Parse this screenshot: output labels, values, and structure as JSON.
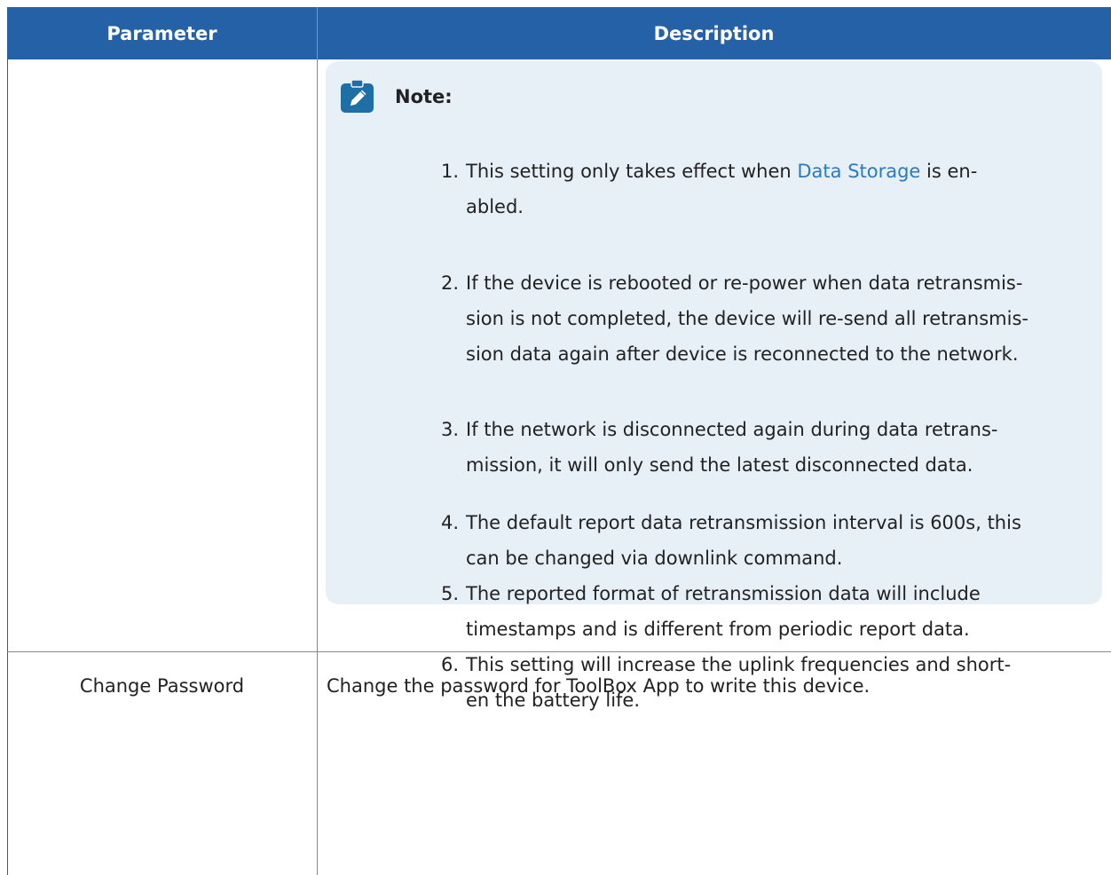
{
  "table": {
    "headers": {
      "parameter": "Parameter",
      "description": "Description"
    },
    "note": {
      "icon": "edit-pencil-icon",
      "title": "Note:",
      "items": [
        {
          "number": "1.",
          "text_before_link": "This setting only takes effect when ",
          "link_text": "Data Storage",
          "text_after_link": " is en-",
          "line2": "abled."
        },
        {
          "number": "2.",
          "line1": "If the device is rebooted or re-power when data retransmis-",
          "line2": "sion is not completed, the device will re-send all retransmis-",
          "line3": "sion data again after device is reconnected to the network."
        },
        {
          "number": "3.",
          "line1": "If the network is disconnected again during data retrans-",
          "line2": "mission, it will only send the latest disconnected data."
        },
        {
          "number": "4.",
          "line1": "The default report data retransmission interval is 600s, this",
          "line2": "can be changed via downlink command."
        },
        {
          "number": "5.",
          "line1": "The reported format of retransmission data will include",
          "line2": "timestamps and is different from periodic report data."
        },
        {
          "number": "6.",
          "line1": "This setting will increase the uplink frequencies and short-",
          "line2": "en the battery life."
        }
      ]
    },
    "rows": [
      {
        "parameter": "Change Password",
        "description": "Change the password for ToolBox App to write this device."
      }
    ]
  },
  "colors": {
    "header_bg": "#2561a6",
    "header_text": "#ffffff",
    "note_bg": "#e8f0f7",
    "note_icon": "#1d6fa5",
    "link": "#2a7ac2"
  }
}
